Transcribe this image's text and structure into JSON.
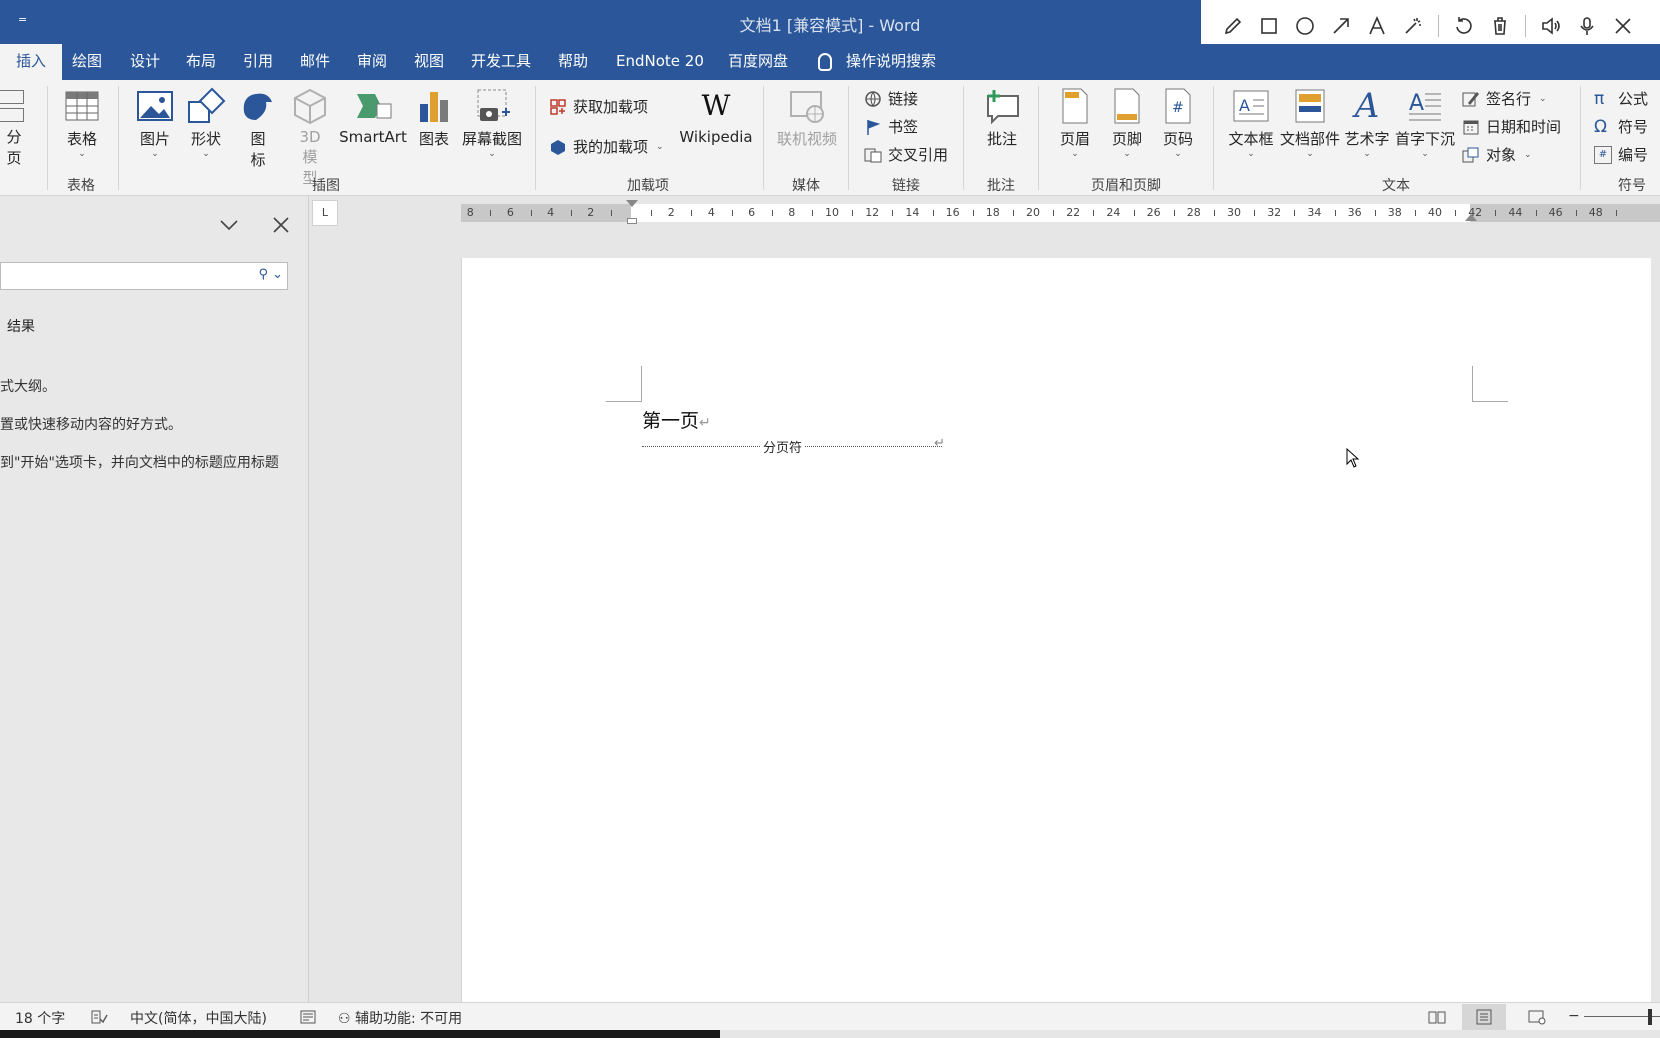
{
  "title_bar": {
    "title": "文档1 [兼容模式]  -  Word",
    "qa_glyph": "="
  },
  "tabs": [
    "插入",
    "绘图",
    "设计",
    "布局",
    "引用",
    "邮件",
    "审阅",
    "视图",
    "开发工具",
    "帮助",
    "EndNote 20",
    "百度网盘"
  ],
  "tell_me": "操作说明搜索",
  "ribbon": {
    "pages_partial": "分页",
    "table": {
      "label": "表格",
      "group": "表格"
    },
    "illustrations": {
      "group": "插图",
      "picture": "图片",
      "shapes": "形状",
      "icons_1": "图",
      "icons_2": "标",
      "model_1": "3D 模",
      "model_2": "型",
      "smartart": "SmartArt",
      "chart": "图表",
      "screenshot": "屏幕截图"
    },
    "addins": {
      "group": "加载项",
      "get": "获取加载项",
      "my": "我的加载项",
      "wikipedia": "Wikipedia",
      "w_glyph": "W"
    },
    "media": {
      "group": "媒体",
      "online_video": "联机视频"
    },
    "links": {
      "group": "链接",
      "link": "链接",
      "bookmark": "书签",
      "cross_ref": "交叉引用"
    },
    "comments": {
      "group": "批注",
      "comment": "批注"
    },
    "header_footer": {
      "group": "页眉和页脚",
      "header": "页眉",
      "footer": "页脚",
      "page_number": "页码"
    },
    "text": {
      "group": "文本",
      "textbox": "文本框",
      "quick_parts": "文档部件",
      "wordart": "艺术字",
      "dropcap": "首字下沉",
      "signature": "签名行",
      "datetime": "日期和时间",
      "object": "对象"
    },
    "symbols": {
      "group": "符号",
      "equation": "公式",
      "symbol": "符号",
      "number": "编号"
    }
  },
  "nav_pane": {
    "results_tab": "结果",
    "para1": "式大纲。",
    "para2": "置或快速移动内容的好方式。",
    "para3": "到\"开始\"选项卡，并向文档中的标题应用标题"
  },
  "ruler": {
    "numbers": [
      "8",
      "6",
      "4",
      "2",
      "2",
      "4",
      "6",
      "8",
      "10",
      "12",
      "14",
      "16",
      "18",
      "20",
      "22",
      "24",
      "26",
      "28",
      "30",
      "32",
      "34",
      "36",
      "38",
      "40",
      "42",
      "44",
      "46",
      "48"
    ],
    "corner": "L"
  },
  "document": {
    "line1": "第一页",
    "page_break": "分页符",
    "para_mark": "↵"
  },
  "status_bar": {
    "word_count": "18 个字",
    "language": "中文(简体，中国大陆)",
    "accessibility": "辅助功能: 不可用",
    "zoom_minus": "−"
  },
  "colors": {
    "accent": "#2b579a",
    "ribbon_bg": "#f3f3f3",
    "canvas": "#e6e6e6"
  }
}
